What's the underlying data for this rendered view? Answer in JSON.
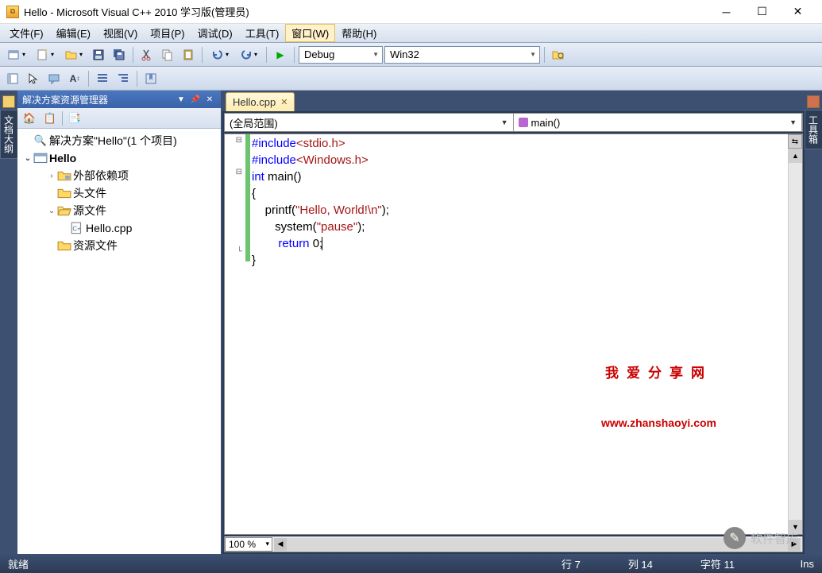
{
  "window": {
    "title": "Hello - Microsoft Visual C++ 2010 学习版(管理员)"
  },
  "menu": {
    "file": "文件(F)",
    "edit": "编辑(E)",
    "view": "视图(V)",
    "project": "项目(P)",
    "debug": "调试(D)",
    "tools": "工具(T)",
    "window": "窗口(W)",
    "help": "帮助(H)"
  },
  "toolbar": {
    "config": "Debug",
    "platform": "Win32"
  },
  "solution_panel": {
    "title": "解决方案资源管理器",
    "root": "解决方案\"Hello\"(1 个项目)",
    "project": "Hello",
    "nodes": {
      "external": "外部依赖项",
      "headers": "头文件",
      "sources": "源文件",
      "resources": "资源文件",
      "file1": "Hello.cpp"
    }
  },
  "left_rail": {
    "label": "文档大纲"
  },
  "right_rail": {
    "label": "工具箱"
  },
  "editor": {
    "tab": "Hello.cpp",
    "scope": "(全局范围)",
    "member": "main()",
    "zoom": "100 %",
    "code": {
      "l1a": "#include",
      "l1b": "<stdio.h>",
      "l2a": "#include",
      "l2b": "<Windows.h>",
      "l3a": "int",
      "l3b": " main()",
      "l4": "{",
      "l5a": "    printf(",
      "l5b": "\"Hello, World!\\n\"",
      "l5c": ");",
      "l6a": "       system(",
      "l6b": "\"pause\"",
      "l6c": ");",
      "l7a": "    return",
      "l7b": " 0;",
      "l8": "}"
    }
  },
  "watermark": {
    "line1": "我爱分享网",
    "line2": "www.zhanshaoyi.com"
  },
  "status": {
    "ready": "就绪",
    "line": "行 7",
    "col": "列 14",
    "char": "字符 11",
    "ins": "Ins"
  },
  "badge": "软件智库"
}
